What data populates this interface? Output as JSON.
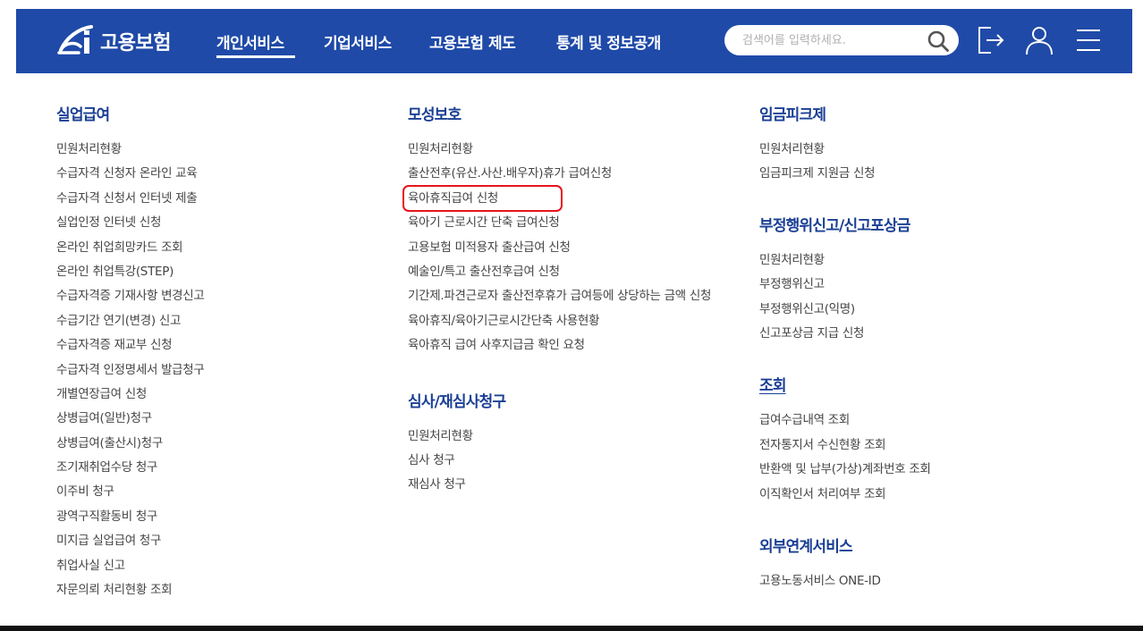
{
  "header": {
    "brand": "고용보험",
    "nav": [
      {
        "label": "개인서비스",
        "active": true
      },
      {
        "label": "기업서비스",
        "active": false
      },
      {
        "label": "고용보험 제도",
        "active": false
      },
      {
        "label": "통계 및 정보공개",
        "active": false
      }
    ],
    "search": {
      "placeholder": "검색어를 입력하세요.",
      "value": ""
    },
    "icons": [
      "search-icon",
      "logout-icon",
      "user-icon",
      "hamburger-menu-icon"
    ],
    "colors": {
      "bar": "#1f4aa8",
      "title": "#1a3f94",
      "highlight": "#e8141b"
    }
  },
  "menu": {
    "columns": [
      {
        "sections": [
          {
            "title": "실업급여",
            "items": [
              "민원처리현황",
              "수급자격 신청자 온라인 교육",
              "수급자격 신청서 인터넷 제출",
              "실업인정 인터넷 신청",
              "온라인 취업희망카드 조회",
              "온라인 취업특강(STEP)",
              "수급자격증 기재사항 변경신고",
              "수급기간 연기(변경) 신고",
              "수급자격증 재교부 신청",
              "수급자격 인정명세서 발급청구",
              "개별연장급여 신청",
              "상병급여(일반)청구",
              "상병급여(출산시)청구",
              "조기재취업수당 청구",
              "이주비 청구",
              "광역구직활동비 청구",
              "미지급 실업급여 청구",
              "취업사실 신고",
              "자문의뢰 처리현황 조회"
            ]
          }
        ]
      },
      {
        "sections": [
          {
            "title": "모성보호",
            "items": [
              "민원처리현황",
              "출산전후(유산.사산.배우자)휴가 급여신청",
              "육아휴직급여 신청",
              "육아기 근로시간 단축 급여신청",
              "고용보험 미적용자 출산급여 신청",
              "예술인/특고 출산전후급여 신청",
              "기간제.파견근로자 출산전후휴가 급여등에 상당하는 금액 신청",
              "육아휴직/육아기근로시간단축 사용현황",
              "육아휴직 급여 사후지급금 확인 요청"
            ]
          },
          {
            "title": "심사/재심사청구",
            "items": [
              "민원처리현황",
              "심사 청구",
              "재심사 청구"
            ]
          }
        ]
      },
      {
        "sections": [
          {
            "title": "임금피크제",
            "items": [
              "민원처리현황",
              "임금피크제 지원금 신청"
            ]
          },
          {
            "title": "부정행위신고/신고포상금",
            "items": [
              "민원처리현황",
              "부정행위신고",
              "부정행위신고(익명)",
              "신고포상금 지급 신청"
            ]
          },
          {
            "title": "조회",
            "items": [
              "급여수급내역 조회",
              "전자통지서 수신현황 조회",
              "반환액 및 납부(가상)계좌번호 조회",
              "이직확인서 처리여부 조회"
            ]
          },
          {
            "title": "외부연계서비스",
            "items": [
              "고용노동서비스 ONE-ID"
            ]
          }
        ]
      }
    ]
  }
}
